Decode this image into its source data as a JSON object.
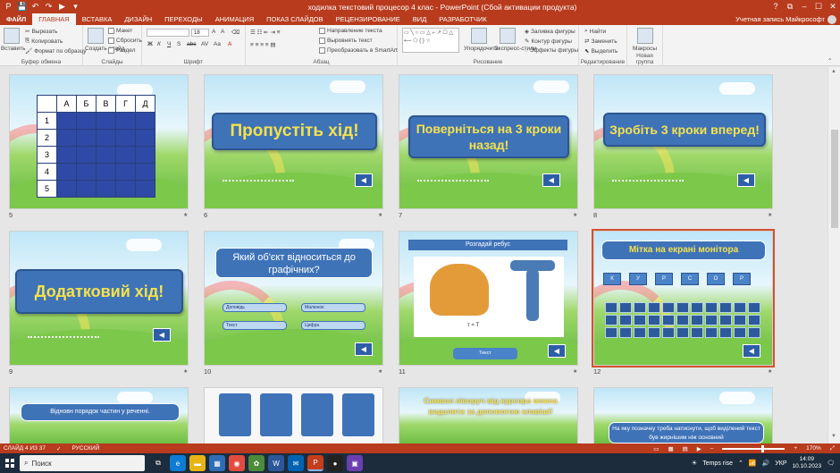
{
  "window": {
    "title": "ходилка текстовий процесор 4 клас - PowerPoint (Сбой активации продукта)",
    "controls": [
      "?",
      "⧉",
      "–",
      "☐",
      "✕"
    ]
  },
  "tabs": [
    {
      "label": "ФАЙЛ"
    },
    {
      "label": "ГЛАВНАЯ"
    },
    {
      "label": "ВСТАВКА"
    },
    {
      "label": "ДИЗАЙН"
    },
    {
      "label": "ПЕРЕХОДЫ"
    },
    {
      "label": "АНИМАЦИЯ"
    },
    {
      "label": "ПОКАЗ СЛАЙДОВ"
    },
    {
      "label": "РЕЦЕНЗИРОВАНИЕ"
    },
    {
      "label": "ВИД"
    },
    {
      "label": "РАЗРАБОТЧИК"
    }
  ],
  "account": "Учетная запись Майкрософт",
  "ribbon": {
    "clipboard": {
      "paste": "Вставить",
      "cut": "Вырезать",
      "copy": "Копировать",
      "format": "Формат по образцу",
      "label": "Буфер обмена"
    },
    "slides": {
      "create": "Создать слайд",
      "layout": "Макет",
      "reset": "Сбросить",
      "section": "Раздел",
      "label": "Слайды"
    },
    "font": {
      "size": "18",
      "label": "Шрифт"
    },
    "paragraph": {
      "direction": "Направление текста",
      "align": "Выровнять текст",
      "smartart": "Преобразовать в SmartArt",
      "label": "Абзац"
    },
    "drawing": {
      "arrange": "Упорядочить",
      "styles": "Экспресс-стили",
      "fill": "Заливка фигуры",
      "outline": "Контур фигуры",
      "effects": "Эффекты фигуры",
      "label": "Рисование"
    },
    "editing": {
      "find": "Найти",
      "replace": "Заменить",
      "select": "Выделить",
      "label": "Редактирование"
    },
    "macros": {
      "btn": "Макросы",
      "label": "Новая группа"
    }
  },
  "slides": [
    {
      "num": "5",
      "type": "table",
      "cols": [
        "А",
        "Б",
        "В",
        "Г",
        "Д"
      ],
      "rows": [
        "1",
        "2",
        "3",
        "4",
        "5"
      ]
    },
    {
      "num": "6",
      "type": "banner",
      "text": "Пропустіть хід!"
    },
    {
      "num": "7",
      "type": "banner",
      "text": "Поверніться на 3 кроки назад!"
    },
    {
      "num": "8",
      "type": "banner",
      "text": "Зробіть 3 кроки вперед!"
    },
    {
      "num": "9",
      "type": "banner",
      "text": "Додатковий хід!"
    },
    {
      "num": "10",
      "type": "question",
      "text": "Який об'єкт відноситься до графічних?",
      "options": [
        "Доповідь",
        "Малюнок",
        "Текст",
        "Цифра"
      ]
    },
    {
      "num": "11",
      "type": "rebus",
      "title": "Розгадай ребус",
      "hint": "т = Т",
      "answer": "Текст"
    },
    {
      "num": "12",
      "type": "keys",
      "title": "Мітка на екрані монітора",
      "keys": [
        "К",
        "У",
        "Р",
        "С",
        "О",
        "Р"
      ]
    },
    {
      "num": "",
      "type": "bubble",
      "text": "Відновн порядок частин у реченні."
    },
    {
      "num": "",
      "type": "cards"
    },
    {
      "num": "",
      "type": "yellowtext",
      "text": "Символ ліворуч від курсора можна видалити за допомогою клавіші!"
    },
    {
      "num": "",
      "type": "bubble2",
      "text": "На яку позначку треба натиснути, щоб виділений текст був жирнішим ніж основний"
    }
  ],
  "status": {
    "slide": "СЛАЙД 4 ИЗ 37",
    "lang": "РУССКИЙ",
    "zoom": "170%"
  },
  "taskbar": {
    "search": "Поиск",
    "weather": "Temps rise",
    "lang": "УКР",
    "time": "14:09",
    "date": "10.10.2023"
  },
  "colors": {
    "accent": "#b83b1d",
    "banner": "#3f73b8",
    "bannerText": "#f5e24b"
  }
}
